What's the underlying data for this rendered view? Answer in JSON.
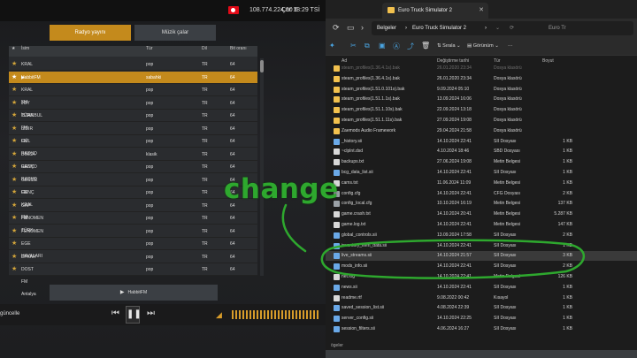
{
  "game": {
    "money": "108.774.224,00 €",
    "clock": "Çar 18:29 TSİ",
    "tabs": {
      "radio": "Radyo yayını",
      "music": "Müzik çalar"
    },
    "table_headers": {
      "name": "İsim",
      "genre": "Tür",
      "lang": "Dil",
      "bitrate": "Bit oranı"
    },
    "stations": [
      {
        "name": "KRAL POP",
        "genre": "pop",
        "lang": "TR",
        "bitrate": "64"
      },
      {
        "name": "HabbitFM",
        "genre": "sabahki",
        "lang": "TR",
        "bitrate": "64",
        "selected": true
      },
      {
        "name": "KRAL FM",
        "genre": "pop",
        "lang": "TR",
        "bitrate": "64"
      },
      {
        "name": "JOY TÜRK",
        "genre": "pop",
        "lang": "TR",
        "bitrate": "64"
      },
      {
        "name": "İSTANBUL FM",
        "genre": "pop",
        "lang": "TR",
        "bitrate": "64"
      },
      {
        "name": "İZDIR FM",
        "genre": "pop",
        "lang": "TR",
        "bitrate": "64"
      },
      {
        "name": "GÜL RADYO",
        "genre": "pop",
        "lang": "TR",
        "bitrate": "64"
      },
      {
        "name": "DİMSA RADYO",
        "genre": "klasik",
        "lang": "TR",
        "bitrate": "64"
      },
      {
        "name": "GENÇ RADYO",
        "genre": "pop",
        "lang": "TR",
        "bitrate": "64"
      },
      {
        "name": "GESİZE FM",
        "genre": "pop",
        "lang": "TR",
        "bitrate": "64"
      },
      {
        "name": "GENÇ KRAL FM",
        "genre": "pop",
        "lang": "TR",
        "bitrate": "64"
      },
      {
        "name": "GAP FM",
        "genre": "pop",
        "lang": "TR",
        "bitrate": "64"
      },
      {
        "name": "FENOMEN TÜRK",
        "genre": "pop",
        "lang": "TR",
        "bitrate": "64"
      },
      {
        "name": "FENOMEN",
        "genre": "pop",
        "lang": "TR",
        "bitrate": "64"
      },
      {
        "name": "EGE HAVALARI",
        "genre": "pop",
        "lang": "TR",
        "bitrate": "64"
      },
      {
        "name": "EFKAR",
        "genre": "pop",
        "lang": "TR",
        "bitrate": "64"
      },
      {
        "name": "DOST FM Antalya",
        "genre": "pop",
        "lang": "TR",
        "bitrate": "64"
      }
    ],
    "now_playing": "HabbitFM",
    "update_label": "güncelle"
  },
  "explorer": {
    "tab_title": "Euro Truck Simulator 2",
    "breadcrumb": [
      "Belgeler",
      "Euro Truck Simulator 2"
    ],
    "search_placeholder": "Euro Tr",
    "cmd": {
      "sort": "Sırala",
      "view": "Görünüm"
    },
    "columns": {
      "name": "Ad",
      "date": "Değiştirme tarihi",
      "type": "Tür",
      "size": "Boyut"
    },
    "files": [
      {
        "name": "steam_profiles(1.36.4.1s).bak",
        "date": "26.01.2020 23:34",
        "type": "Dosya klasörü",
        "size": "",
        "icon": "folder",
        "dim": true
      },
      {
        "name": "steam_profiles(1.36.4.1s).bak",
        "date": "26.01.2020 23:34",
        "type": "Dosya klasörü",
        "size": "",
        "icon": "folder"
      },
      {
        "name": "steam_profiles(1.51.0.101s).bak",
        "date": "9.09.2024 05:10",
        "type": "Dosya klasörü",
        "size": "",
        "icon": "folder"
      },
      {
        "name": "steam_profiles(1.51.1.1s).bak",
        "date": "13.09.2024 16:06",
        "type": "Dosya klasörü",
        "size": "",
        "icon": "folder"
      },
      {
        "name": "steam_profiles(1.51.1.10s).bak",
        "date": "22.09.2024 13:18",
        "type": "Dosya klasörü",
        "size": "",
        "icon": "folder"
      },
      {
        "name": "steam_profiles(1.51.1.11s).bak",
        "date": "27.09.2024 19:08",
        "type": "Dosya klasörü",
        "size": "",
        "icon": "folder"
      },
      {
        "name": "Zaemods Audio Framework",
        "date": "29.04.2024 21:58",
        "type": "Dosya klasörü",
        "size": "",
        "icon": "folder"
      },
      {
        "name": "_history.sii",
        "date": "14.10.2024 22:41",
        "type": "SII Dosyası",
        "size": "1 KB",
        "icon": "sii"
      },
      {
        "name": "~clplnt.dsd",
        "date": "4.10.2024 18:46",
        "type": "SBD Dosyası",
        "size": "1 KB",
        "icon": "file"
      },
      {
        "name": "backups.txt",
        "date": "27.06.2024 19:08",
        "type": "Metin Belgesi",
        "size": "1 KB",
        "icon": "file"
      },
      {
        "name": "bcg_data_list.sii",
        "date": "14.10.2024 22:41",
        "type": "SII Dosyası",
        "size": "1 KB",
        "icon": "sii"
      },
      {
        "name": "cams.txt",
        "date": "11.06.2024 11:09",
        "type": "Metin Belgesi",
        "size": "1 KB",
        "icon": "file"
      },
      {
        "name": "config.cfg",
        "date": "14.10.2024 22:41",
        "type": "CFG Dosyası",
        "size": "2 KB",
        "icon": "cfg"
      },
      {
        "name": "config_local.cfg",
        "date": "10.10.2024 16:19",
        "type": "Metin Belgesi",
        "size": "137 KB",
        "icon": "cfg"
      },
      {
        "name": "game.crash.txt",
        "date": "14.10.2024 20:41",
        "type": "Metin Belgesi",
        "size": "5.287 KB",
        "icon": "file"
      },
      {
        "name": "game.log.txt",
        "date": "14.10.2024 22:41",
        "type": "Metin Belgesi",
        "size": "147 KB",
        "icon": "file"
      },
      {
        "name": "global_controls.sii",
        "date": "13.09.2024 17:58",
        "type": "SII Dosyası",
        "size": "2 KB",
        "icon": "sii"
      },
      {
        "name": "inventory_item_data.sii",
        "date": "14.10.2024 22:41",
        "type": "SII Dosyası",
        "size": "1 KB",
        "icon": "sii"
      },
      {
        "name": "live_streams.sii",
        "date": "14.10.2024 21:57",
        "type": "SII Dosyası",
        "size": "3 KB",
        "icon": "sii",
        "selected": true
      },
      {
        "name": "mods_info.sii",
        "date": "14.10.2024 22:41",
        "type": "SII Dosyası",
        "size": "2 KB",
        "icon": "sii"
      },
      {
        "name": "net.log",
        "date": "14.10.2024 22:41",
        "type": "Metin Belgesi",
        "size": "126 KB",
        "icon": "file"
      },
      {
        "name": "news.sii",
        "date": "14.10.2024 22:41",
        "type": "SII Dosyası",
        "size": "1 KB",
        "icon": "sii"
      },
      {
        "name": "readme.rtf",
        "date": "9.08.2022 00:42",
        "type": "Kısayol",
        "size": "1 KB",
        "icon": "file"
      },
      {
        "name": "saved_session_list.sii",
        "date": "4.08.2024 22:39",
        "type": "SII Dosyası",
        "size": "1 KB",
        "icon": "sii"
      },
      {
        "name": "server_config.sii",
        "date": "14.10.2024 22:25",
        "type": "SII Dosyası",
        "size": "1 KB",
        "icon": "sii"
      },
      {
        "name": "session_filters.sii",
        "date": "4.06.2024 16:27",
        "type": "SII Dosyası",
        "size": "1 KB",
        "icon": "sii"
      }
    ],
    "status": "ögeler"
  },
  "overlay": {
    "word": "change",
    "color": "#2ea82e"
  }
}
